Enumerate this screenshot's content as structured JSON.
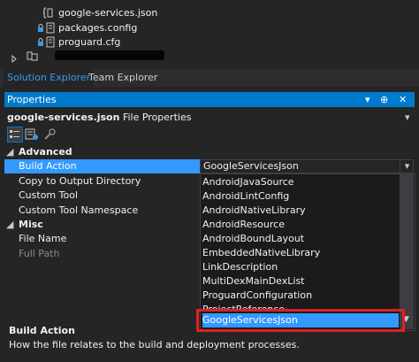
{
  "tree": {
    "items": [
      {
        "label": "google-services.json",
        "icon": "json-file-icon"
      },
      {
        "label": "packages.config",
        "icon": "locked-config-file-icon"
      },
      {
        "label": "proguard.cfg",
        "icon": "locked-config-file-icon"
      }
    ]
  },
  "tabs": [
    {
      "label": "Solution Explorer"
    },
    {
      "label": "Team Explorer"
    }
  ],
  "properties": {
    "title": "Properties",
    "window_buttons": {
      "dropdown": "▾",
      "pin": "⊕",
      "close": "✕"
    },
    "object_name": "google-services.json",
    "object_type": "File Properties",
    "categories": [
      {
        "name": "Advanced",
        "rows": [
          {
            "name": "Build Action",
            "value": "GoogleServicesJson"
          },
          {
            "name": "Copy to Output Directory",
            "value": ""
          },
          {
            "name": "Custom Tool",
            "value": ""
          },
          {
            "name": "Custom Tool Namespace",
            "value": ""
          }
        ]
      },
      {
        "name": "Misc",
        "rows": [
          {
            "name": "File Name",
            "value": ""
          },
          {
            "name": "Full Path",
            "value": ""
          }
        ]
      }
    ],
    "dropdown_options": [
      "AndroidJavaSource",
      "AndroidLintConfig",
      "AndroidNativeLibrary",
      "AndroidResource",
      "AndroidBoundLayout",
      "EmbeddedNativeLibrary",
      "LinkDescription",
      "MultiDexMainDexList",
      "ProguardConfiguration",
      "ProjectReference",
      "GoogleServicesJson"
    ],
    "selected_option": "GoogleServicesJson",
    "description": {
      "title": "Build Action",
      "text": "How the file relates to the build and deployment processes."
    }
  },
  "colors": {
    "accent": "#007acc",
    "selection": "#3399ff",
    "highlight_box": "#e02020",
    "active_tab_text": "#3b9ae6"
  }
}
